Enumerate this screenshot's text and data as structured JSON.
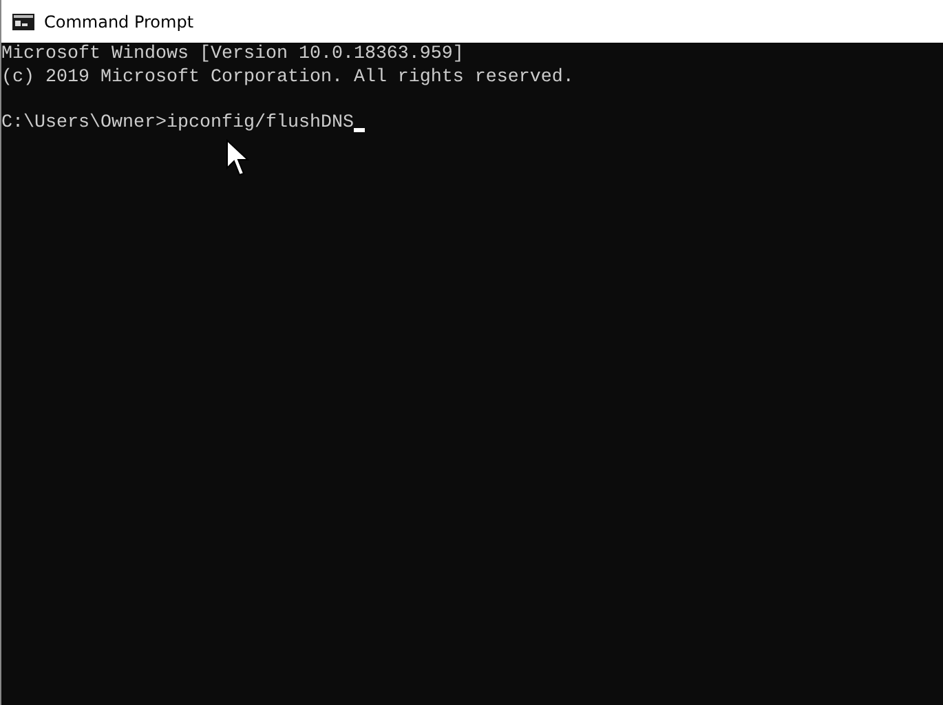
{
  "window": {
    "title": "Command Prompt"
  },
  "console": {
    "lines": [
      {
        "kind": "output",
        "text": "Microsoft Windows [Version 10.0.18363.959]"
      },
      {
        "kind": "output",
        "text": "(c) 2019 Microsoft Corporation. All rights reserved."
      },
      {
        "kind": "blank"
      },
      {
        "kind": "input",
        "text": "C:\\Users\\Owner>ipconfig/flushDNS"
      }
    ]
  }
}
